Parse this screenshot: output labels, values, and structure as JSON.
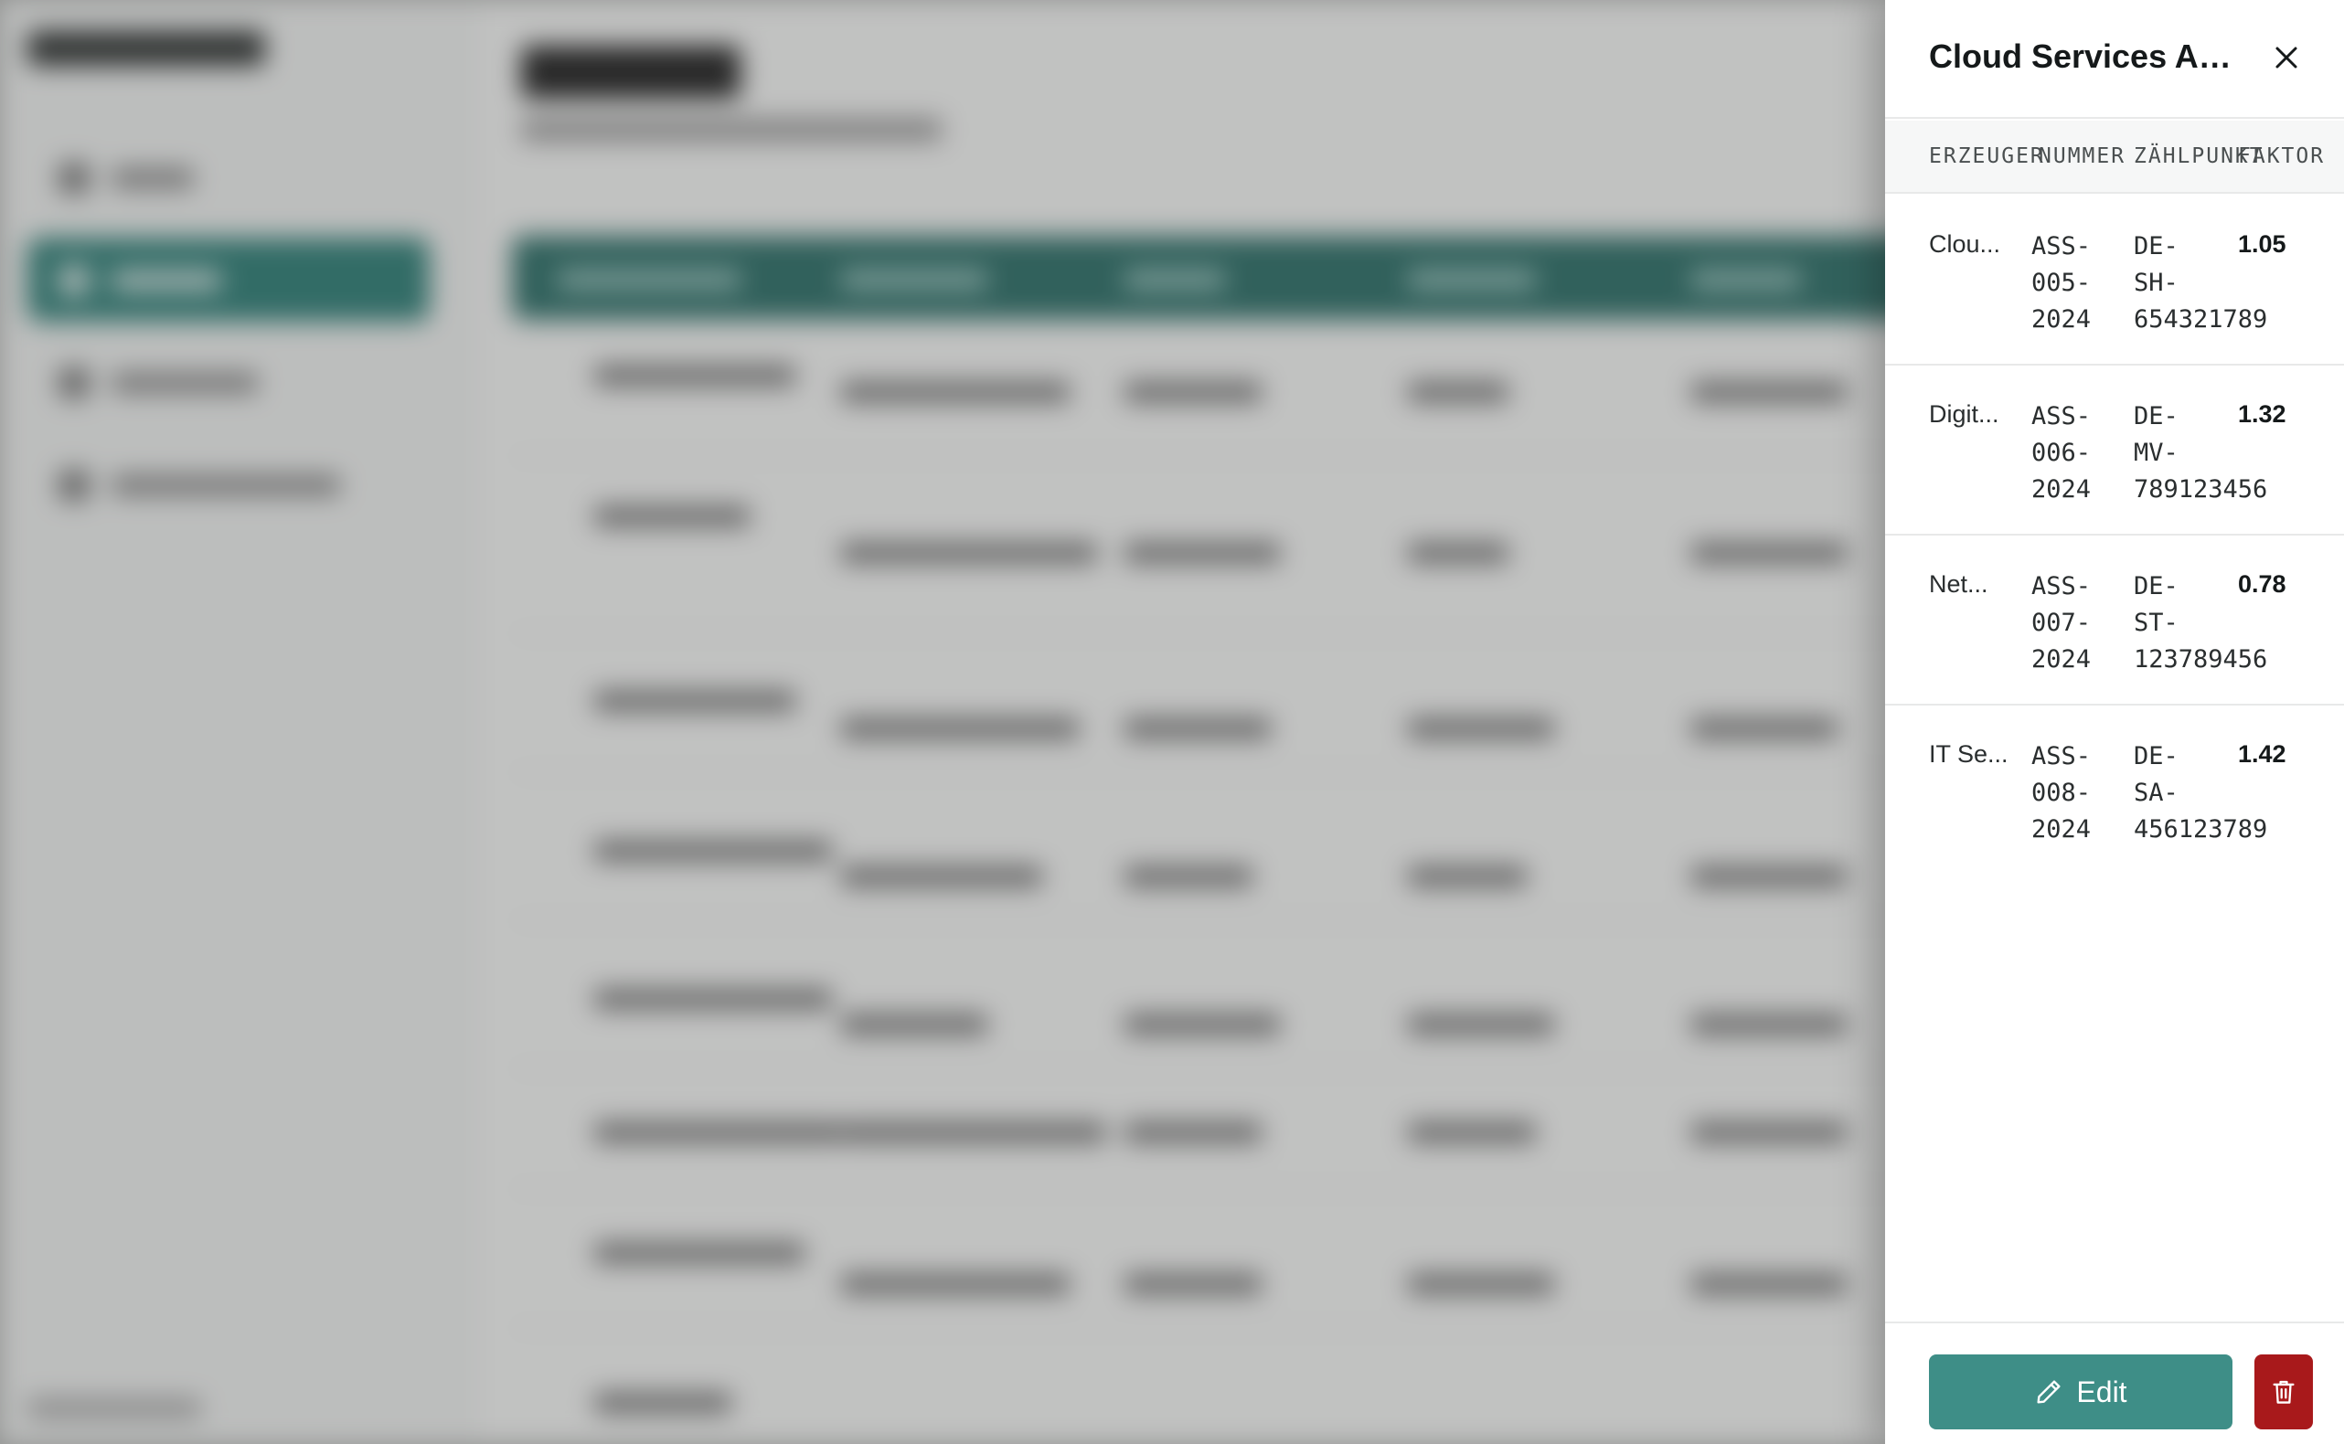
{
  "panel": {
    "title": "Cloud Services Ag...",
    "columns": [
      "ERZEUGER",
      "NUMMER",
      "ZÄHLPUNKT",
      "FAKTOR"
    ],
    "rows": [
      {
        "erzeuger": "Clou...",
        "nummer": "ASS-\n005-\n2024",
        "zaehlpunkt": "DE-\nSH-\n654321789",
        "faktor": "1.05"
      },
      {
        "erzeuger": "Digit...",
        "nummer": "ASS-\n006-\n2024",
        "zaehlpunkt": "DE-\nMV-\n789123456",
        "faktor": "1.32"
      },
      {
        "erzeuger": "Net...",
        "nummer": "ASS-\n007-\n2024",
        "zaehlpunkt": "DE-\nST-\n123789456",
        "faktor": "0.78"
      },
      {
        "erzeuger": "IT Se...",
        "nummer": "ASS-\n008-\n2024",
        "zaehlpunkt": "DE-\nSA-\n456123789",
        "faktor": "1.42"
      }
    ],
    "edit_label": "Edit"
  },
  "icons": {
    "close": "close-icon",
    "edit": "pencil-icon",
    "delete": "trash-icon"
  },
  "colors": {
    "primary": "#3e8e87",
    "danger": "#a8191b",
    "background_accent": "#2f7f77"
  }
}
